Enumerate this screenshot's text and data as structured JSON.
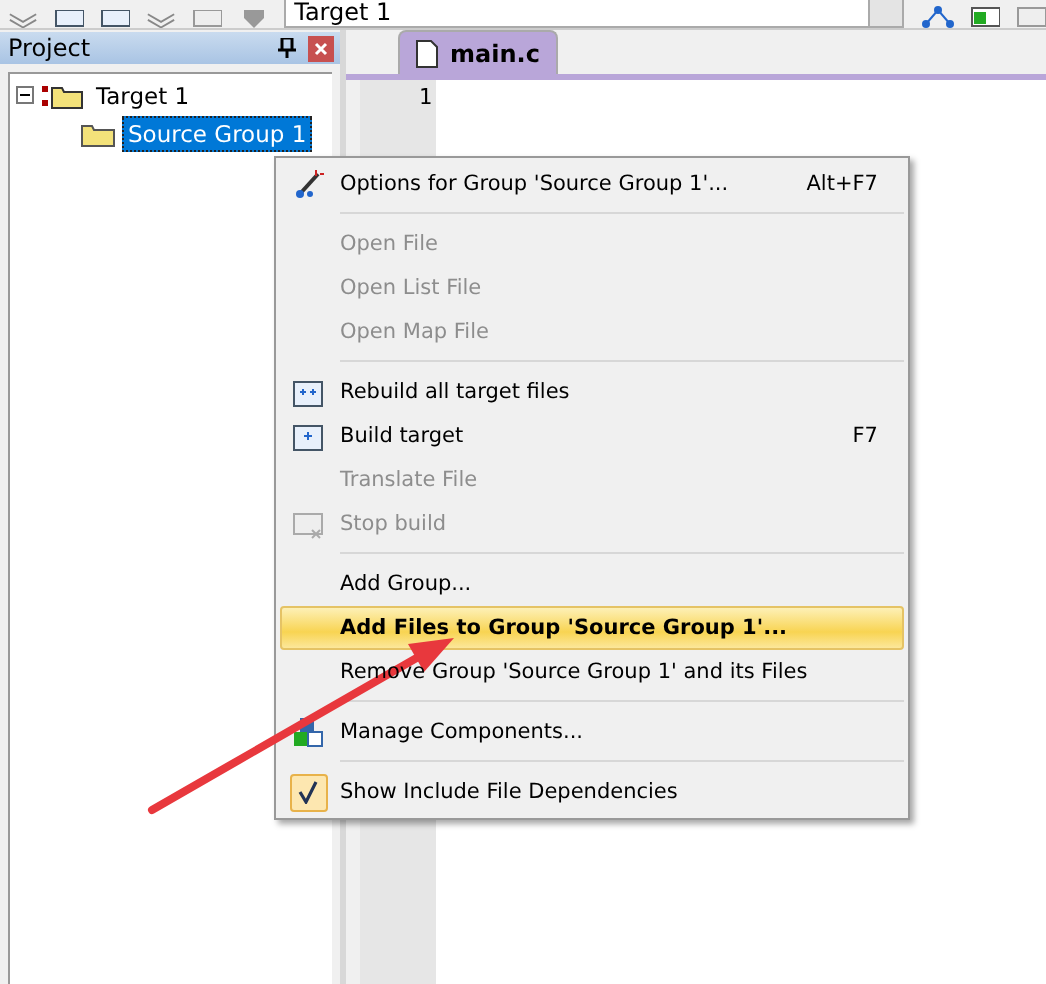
{
  "toolbar": {
    "target_select": "Target 1"
  },
  "project_panel": {
    "title": "Project",
    "tree": [
      {
        "label": "Target 1",
        "expanded": true,
        "selected": false,
        "children": [
          {
            "label": "Source Group 1",
            "selected": true
          }
        ]
      }
    ]
  },
  "editor": {
    "tabs": [
      {
        "label": "main.c",
        "selected": true
      }
    ],
    "line_numbers": [
      "1"
    ]
  },
  "context_menu": {
    "items": [
      {
        "kind": "item",
        "label": "Options for Group 'Source Group 1'...",
        "shortcut": "Alt+F7",
        "disabled": false,
        "selected": false
      },
      {
        "kind": "separator"
      },
      {
        "kind": "item",
        "label": "Open File",
        "disabled": true,
        "selected": false
      },
      {
        "kind": "item",
        "label": "Open List File",
        "disabled": true,
        "selected": false
      },
      {
        "kind": "item",
        "label": "Open Map File",
        "disabled": true,
        "selected": false
      },
      {
        "kind": "separator"
      },
      {
        "kind": "item",
        "label": "Rebuild all target files",
        "disabled": false,
        "selected": false
      },
      {
        "kind": "item",
        "label": "Build target",
        "shortcut": "F7",
        "disabled": false,
        "selected": false
      },
      {
        "kind": "item",
        "label": "Translate File",
        "disabled": true,
        "selected": false
      },
      {
        "kind": "item",
        "label": "Stop build",
        "disabled": true,
        "selected": false
      },
      {
        "kind": "separator"
      },
      {
        "kind": "item",
        "label": "Add Group...",
        "disabled": false,
        "selected": false
      },
      {
        "kind": "item",
        "label": "Add Files to Group 'Source Group 1'...",
        "disabled": false,
        "selected": true
      },
      {
        "kind": "item",
        "label": "Remove Group 'Source Group 1' and its Files",
        "disabled": false,
        "selected": false
      },
      {
        "kind": "separator"
      },
      {
        "kind": "item",
        "label": "Manage Components...",
        "disabled": false,
        "selected": false
      },
      {
        "kind": "separator"
      },
      {
        "kind": "item",
        "label": "Show Include File Dependencies",
        "disabled": false,
        "selected": false,
        "checked": true
      }
    ]
  }
}
